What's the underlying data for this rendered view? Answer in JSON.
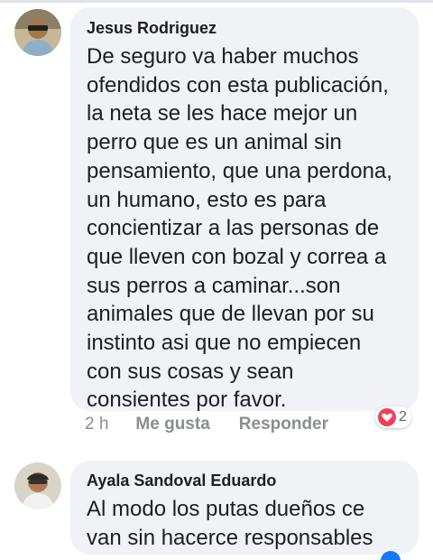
{
  "comments": [
    {
      "author": "Jesus Rodriguez",
      "text": "De seguro va haber muchos\nofendidos con esta publicación,\nla neta se les hace mejor un\nperro que es un animal sin\npensamiento, que una perdona,\nun humano, esto es para\nconcientizar a las personas de\nque lleven con bozal y correa a\nsus perros a caminar...son\nanimales que de llevan por su\ninstinto asi que no empiecen\ncon sus cosas y sean\nconsientes por favor.",
      "time": "2 h",
      "like_label": "Me gusta",
      "reply_label": "Responder",
      "reaction_icon": "love-icon",
      "reaction_count": "2"
    },
    {
      "author": "Ayala Sandoval Eduardo",
      "text": "Al modo los putas dueños ce\nvan sin hacerce responsables"
    }
  ],
  "colors": {
    "bubble": "#f0f2f5",
    "text": "#1c1e21",
    "meta": "#8a8d91",
    "love": "#f33e58",
    "accent": "#1877f2"
  }
}
